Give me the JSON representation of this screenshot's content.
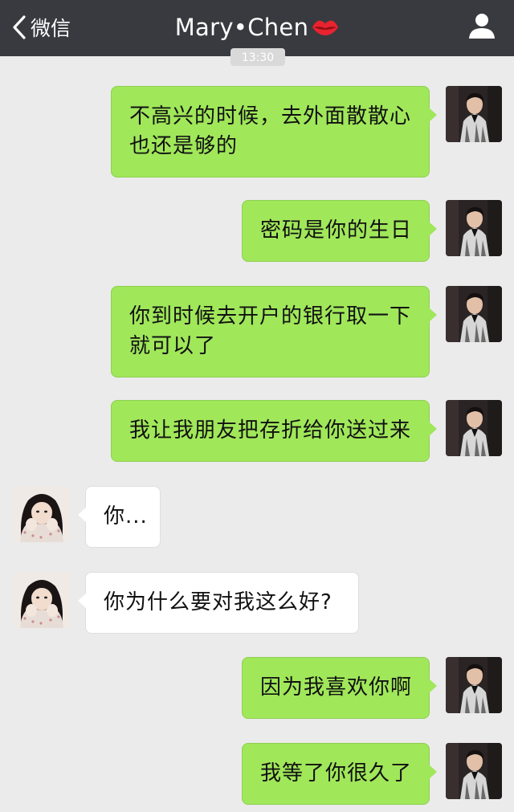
{
  "nav": {
    "back_label": "微信",
    "title": "Mary•Chen",
    "title_emoji": "lips-icon",
    "profile_icon": "person-icon"
  },
  "timestamp": "13:30",
  "colors": {
    "nav_bg": "#393a3f",
    "chat_bg": "#ebebeb",
    "outgoing_bubble": "#a0e75a",
    "incoming_bubble": "#ffffff"
  },
  "messages": [
    {
      "side": "out",
      "lines": [
        "不高兴的时候，去外面散散心",
        "也还是够的"
      ]
    },
    {
      "side": "out",
      "lines": [
        "密码是你的生日"
      ]
    },
    {
      "side": "out",
      "lines": [
        "你到时候去开户的银行取一下",
        "就可以了"
      ]
    },
    {
      "side": "out",
      "lines": [
        "我让我朋友把存折给你送过来"
      ]
    },
    {
      "side": "in",
      "lines": [
        "你..."
      ]
    },
    {
      "side": "in",
      "lines": [
        "你为什么要对我这么好?"
      ]
    },
    {
      "side": "out",
      "lines": [
        "因为我喜欢你啊"
      ]
    },
    {
      "side": "out",
      "lines": [
        "我等了你很久了"
      ]
    }
  ]
}
